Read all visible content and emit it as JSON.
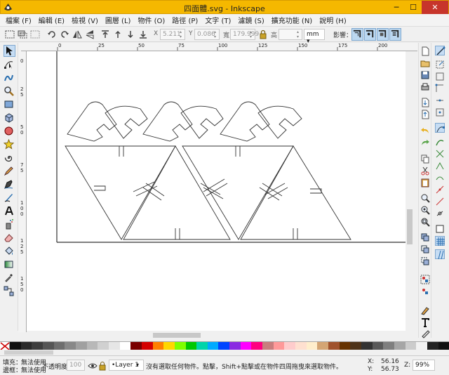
{
  "window": {
    "title": "四面體.svg - Inkscape",
    "minimize": "─",
    "maximize": "☐",
    "close": "✕"
  },
  "menu": [
    "檔案 (F)",
    "編輯 (E)",
    "檢視 (V)",
    "圖層 (L)",
    "物件 (O)",
    "路徑 (P)",
    "文字 (T)",
    "濾鏡 (S)",
    "擴充功能 (N)",
    "說明 (H)"
  ],
  "controls": {
    "x_label": "X",
    "x_value": "5.211",
    "y_label": "Y",
    "y_value": "0.086",
    "w_label": "寬",
    "w_value": "179.999",
    "h_label": "高",
    "h_value": "",
    "unit": "mm ▾",
    "affect_label": "影響："
  },
  "ruler": {
    "top_ticks": [
      "0",
      "25",
      "50",
      "75",
      "100",
      "125",
      "150",
      "175",
      "200"
    ],
    "left_ticks": [
      "0",
      "2",
      "5",
      "5",
      "0",
      "7",
      "5",
      "1",
      "0",
      "0",
      "1",
      "2",
      "5",
      "1",
      "5",
      "0"
    ]
  },
  "palette": [
    "#111111",
    "#2a2a2a",
    "#3d3d3d",
    "#555555",
    "#6e6e6e",
    "#888888",
    "#a0a0a0",
    "#b8b8b8",
    "#d0d0d0",
    "#e6e6e6",
    "#ffffff",
    "#7a0000",
    "#d40000",
    "#ff7f00",
    "#ffd700",
    "#7fff00",
    "#00c800",
    "#00d4aa",
    "#00aaff",
    "#0044ff",
    "#8a2be2",
    "#ff00ff",
    "#ff0080",
    "#c87d7d",
    "#ff9999",
    "#ffcccc",
    "#ffe0d0",
    "#ffeecc",
    "#d4a574",
    "#a0522d",
    "#663300",
    "#4d3319",
    "#333333",
    "#595959",
    "#7f7f7f",
    "#a6a6a6",
    "#cccccc",
    "#f2f2f2",
    "#222222",
    "#111111"
  ],
  "status": {
    "fill_label": "填充：",
    "fill_value": "無法使用",
    "stroke_label": "邊框：",
    "stroke_value": "無法使用",
    "opacity_label": "不透明度：",
    "opacity_value": "100",
    "layer": "•Layer 1",
    "message": "沒有選取任何物件。點擊，Shift+點擊或在物件四周拖曳來選取物件。",
    "x_label": "X:",
    "x_value": "56.16",
    "y_label": "Y:",
    "y_value": "56.73",
    "zoom_label": "Z:",
    "zoom_value": "99%"
  }
}
